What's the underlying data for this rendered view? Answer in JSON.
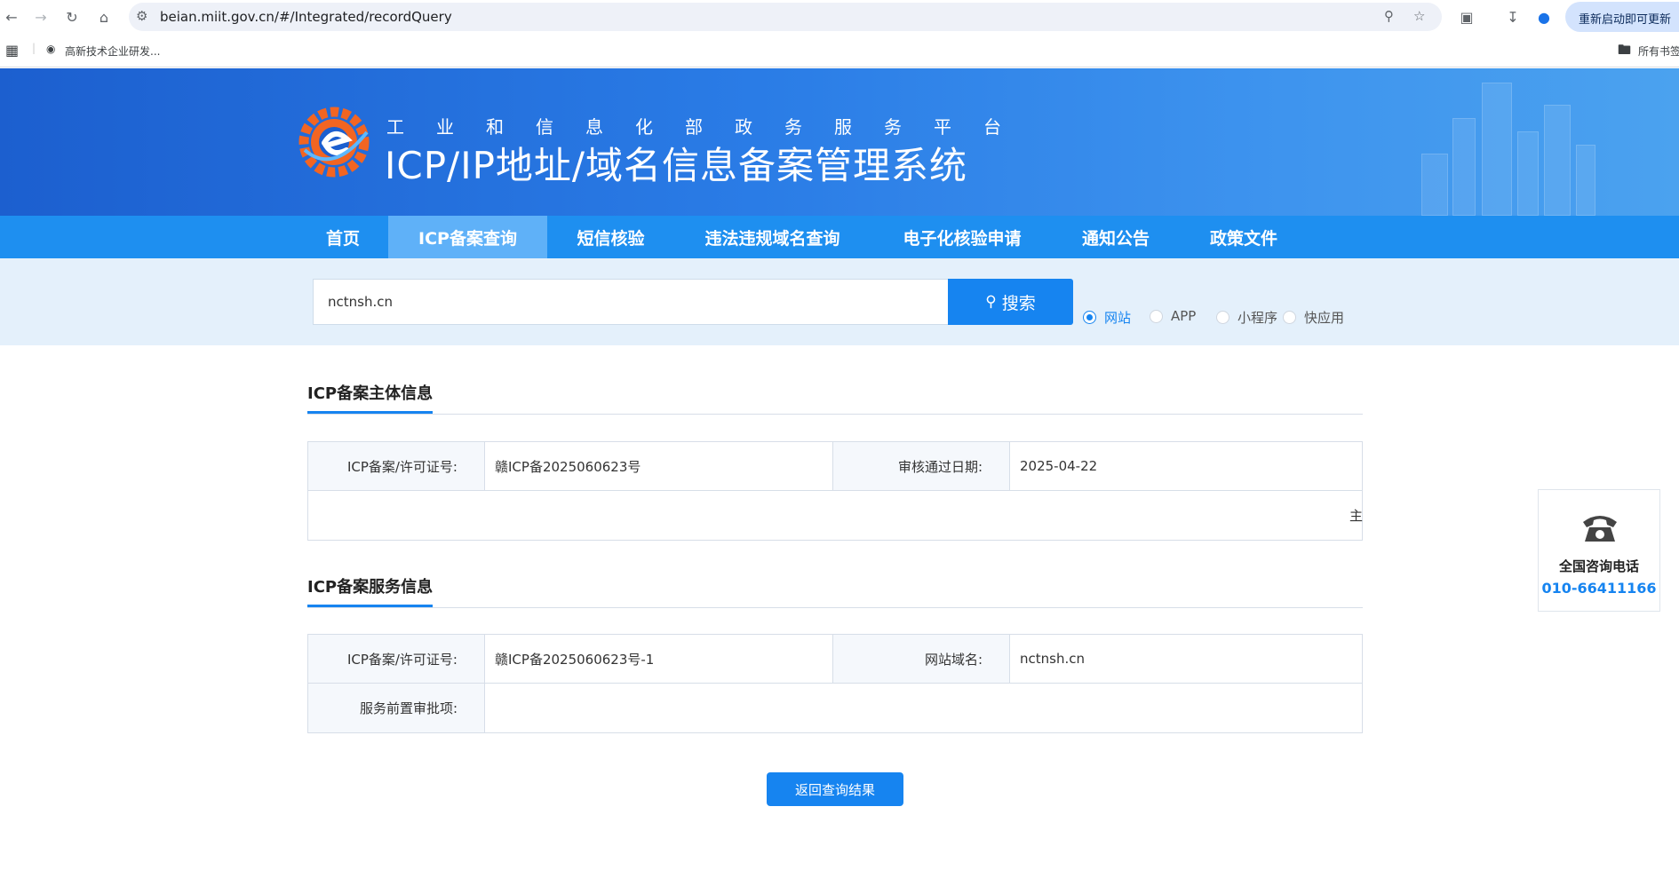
{
  "browser": {
    "url": "beian.miit.gov.cn/#/Integrated/recordQuery",
    "restart_label": "重新启动即可更新",
    "bookmark_label": "高新技术企业研发...",
    "all_bookmarks_label": "所有书签"
  },
  "header": {
    "subtitle": "工业和信息化部政务服务平台",
    "title": "ICP/IP地址/域名信息备案管理系统"
  },
  "nav": {
    "items": [
      {
        "label": "首页"
      },
      {
        "label": "ICP备案查询"
      },
      {
        "label": "短信核验"
      },
      {
        "label": "违法违规域名查询"
      },
      {
        "label": "电子化核验申请"
      },
      {
        "label": "通知公告"
      },
      {
        "label": "政策文件"
      }
    ],
    "active_index": 1
  },
  "search": {
    "value": "nctnsh.cn",
    "button_label": "搜索",
    "types": [
      {
        "label": "网站",
        "checked": true
      },
      {
        "label": "APP",
        "checked": false
      },
      {
        "label": "小程序",
        "checked": false
      },
      {
        "label": "快应用",
        "checked": false
      }
    ]
  },
  "subject_info": {
    "title": "ICP备案主体信息",
    "license_label": "ICP备案/许可证号:",
    "license_value": "赣ICP备2025060623号",
    "date_label": "审核通过日期:",
    "date_value": "2025-04-22",
    "clipped_text": "主"
  },
  "service_info": {
    "title": "ICP备案服务信息",
    "license_label": "ICP备案/许可证号:",
    "license_value": "赣ICP备2025060623号-1",
    "domain_label": "网站域名:",
    "domain_value": "nctnsh.cn",
    "approval_label": "服务前置审批项:",
    "approval_value": ""
  },
  "back_button_label": "返回查询结果",
  "consult": {
    "label": "全国咨询电话",
    "phone": "010-66411166"
  },
  "colors": {
    "primary": "#1684f0",
    "nav_bg": "#1e8ff0",
    "nav_active": "#5fb1f8",
    "search_band": "#e4f0fb"
  }
}
